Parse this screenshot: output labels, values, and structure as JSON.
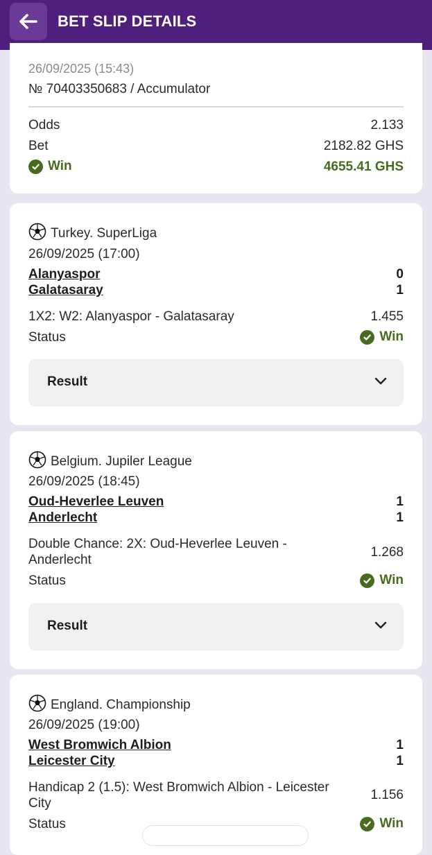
{
  "header": {
    "title": "BET SLIP DETAILS",
    "back_icon": "arrow-left-icon"
  },
  "summary": {
    "date": "26/09/2025 (15:43)",
    "ticket": "№ 70403350683 / Accumulator",
    "odds_label": "Odds",
    "odds_value": "2.133",
    "bet_label": "Bet",
    "bet_value": "2182.82 GHS",
    "result_label": "Win",
    "payout": "4655.41 GHS"
  },
  "events": [
    {
      "league": "Turkey. SuperLiga",
      "date": "26/09/2025 (17:00)",
      "home": "Alanyaspor",
      "home_score": "0",
      "away": "Galatasaray",
      "away_score": "1",
      "market": "1X2: W2: Alanyaspor - Galatasaray",
      "odd": "1.455",
      "status_label": "Status",
      "status": "Win",
      "result_label": "Result"
    },
    {
      "league": "Belgium. Jupiler League",
      "date": "26/09/2025 (18:45)",
      "home": "Oud-Heverlee Leuven",
      "home_score": "1",
      "away": "Anderlecht",
      "away_score": "1",
      "market_line1": "Double Chance: 2X: Oud-Heverlee Leuven -",
      "market_line2": "Anderlecht",
      "odd": "1.268",
      "status_label": "Status",
      "status": "Win",
      "result_label": "Result"
    },
    {
      "league": "England. Championship",
      "date": "26/09/2025 (19:00)",
      "home": "West Bromwich Albion",
      "home_score": "1",
      "away": "Leicester City",
      "away_score": "1",
      "market_line1": "Handicap 2 (1.5): West Bromwich Albion - Leicester",
      "market_line2": "City",
      "odd": "1.156",
      "status_label": "Status",
      "status": "Win"
    }
  ],
  "colors": {
    "header": "#4f1f7d",
    "win": "#4a6a1f",
    "background": "#e8e4f0"
  }
}
